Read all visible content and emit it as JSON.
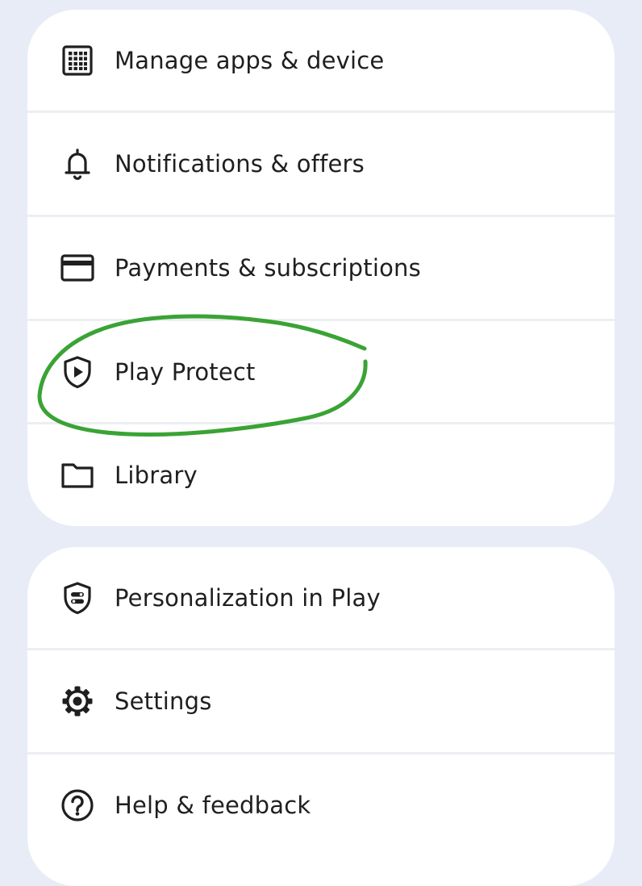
{
  "menu_group_1": {
    "items": [
      {
        "label": "Manage apps & device",
        "icon": "apps-grid-icon"
      },
      {
        "label": "Notifications & offers",
        "icon": "bell-icon"
      },
      {
        "label": "Payments & subscriptions",
        "icon": "credit-card-icon"
      },
      {
        "label": "Play Protect",
        "icon": "play-protect-shield-icon"
      },
      {
        "label": "Library",
        "icon": "folder-icon"
      }
    ]
  },
  "menu_group_2": {
    "items": [
      {
        "label": "Personalization in Play",
        "icon": "personalization-shield-icon"
      },
      {
        "label": "Settings",
        "icon": "gear-icon"
      },
      {
        "label": "Help & feedback",
        "icon": "help-icon"
      }
    ]
  },
  "colors": {
    "background": "#e8ecf7",
    "card": "#ffffff",
    "text": "#1f1f1f",
    "annotation": "#3aa335"
  }
}
